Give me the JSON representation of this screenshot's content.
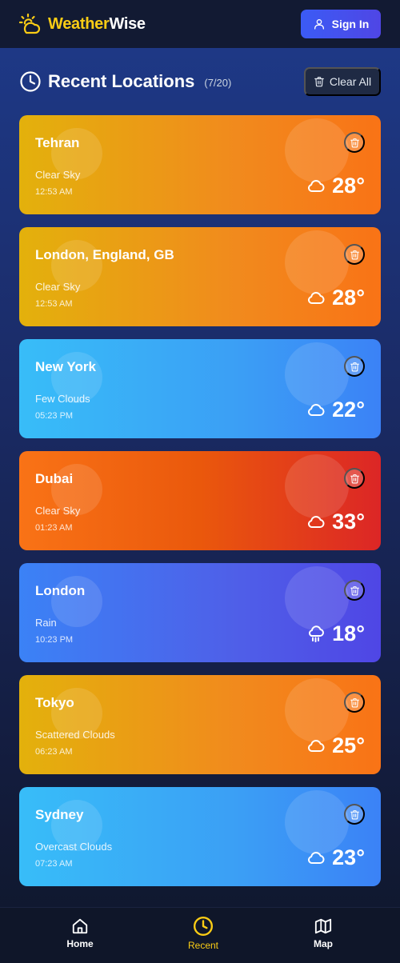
{
  "header": {
    "brand_part1": "Weather",
    "brand_part2": "Wise",
    "sign_in_label": "Sign In"
  },
  "recent": {
    "title": "Recent Locations",
    "count": "(7/20)",
    "clear_all_label": "Clear All"
  },
  "locations": [
    {
      "city": "Tehran",
      "condition": "Clear Sky",
      "time": "12:53 AM",
      "temp": "28°",
      "theme": "sunny",
      "icon": "cloud-icon"
    },
    {
      "city": "London, England, GB",
      "condition": "Clear Sky",
      "time": "12:53 AM",
      "temp": "28°",
      "theme": "sunny",
      "icon": "cloud-icon"
    },
    {
      "city": "New York",
      "condition": "Few Clouds",
      "time": "05:23 PM",
      "temp": "22°",
      "theme": "cool",
      "icon": "cloud-icon"
    },
    {
      "city": "Dubai",
      "condition": "Clear Sky",
      "time": "01:23 AM",
      "temp": "33°",
      "theme": "hot",
      "icon": "cloud-icon"
    },
    {
      "city": "London",
      "condition": "Rain",
      "time": "10:23 PM",
      "temp": "18°",
      "theme": "rain",
      "icon": "rain-cloud-icon"
    },
    {
      "city": "Tokyo",
      "condition": "Scattered Clouds",
      "time": "06:23 AM",
      "temp": "25°",
      "theme": "sunny",
      "icon": "cloud-icon"
    },
    {
      "city": "Sydney",
      "condition": "Overcast Clouds",
      "time": "07:23 AM",
      "temp": "23°",
      "theme": "cool",
      "icon": "cloud-icon"
    }
  ],
  "nav": {
    "home_label": "Home",
    "recent_label": "Recent",
    "map_label": "Map",
    "active": "recent"
  },
  "colors": {
    "brand_accent": "#facc15",
    "primary_button": "#4f46e5",
    "active_nav": "#facc15"
  }
}
